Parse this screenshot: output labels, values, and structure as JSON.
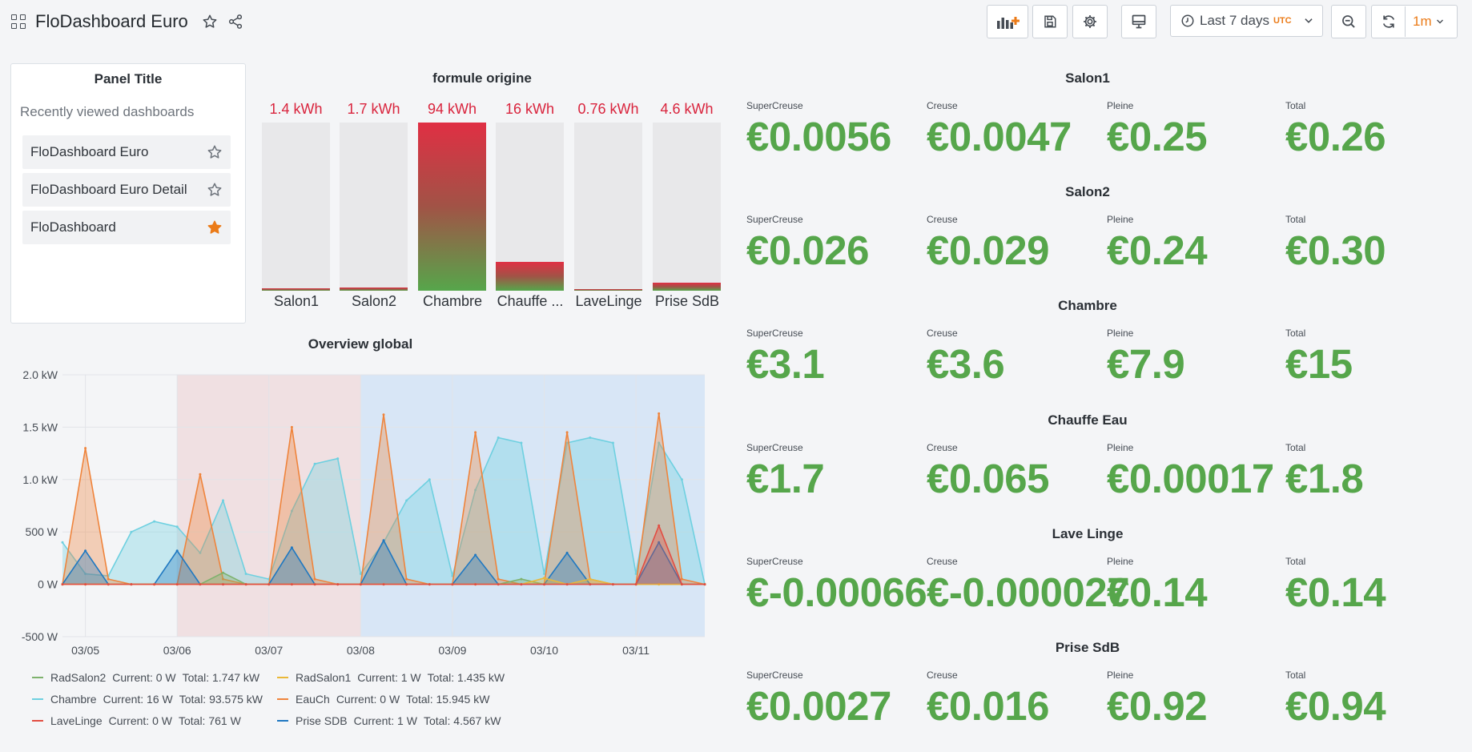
{
  "header": {
    "title": "FloDashboard Euro",
    "time_range": "Last 7 days",
    "timezone": "UTC",
    "refresh_interval": "1m"
  },
  "recent_panel": {
    "title": "Panel Title",
    "subtitle": "Recently viewed dashboards",
    "items": [
      {
        "label": "FloDashboard Euro",
        "starred": false
      },
      {
        "label": "FloDashboard Euro Detail",
        "starred": false
      },
      {
        "label": "FloDashboard",
        "starred": true
      }
    ]
  },
  "bar_gauge": {
    "title": "formule origine",
    "items": [
      {
        "label": "Salon1",
        "value": "1.4 kWh",
        "level": 0.015
      },
      {
        "label": "Salon2",
        "value": "1.7 kWh",
        "level": 0.018
      },
      {
        "label": "Chambre",
        "value": "94 kWh",
        "level": 1.0
      },
      {
        "label": "Chauffe ...",
        "value": "16 kWh",
        "level": 0.17
      },
      {
        "label": "LaveLinge",
        "value": "0.76 kWh",
        "level": 0.008
      },
      {
        "label": "Prise SdB",
        "value": "4.6 kWh",
        "level": 0.049
      }
    ]
  },
  "overview": {
    "title": "Overview global",
    "y_ticks": [
      "2.0 kW",
      "1.5 kW",
      "1.0 kW",
      "500 W",
      "0 W",
      "-500 W"
    ],
    "x_ticks": [
      "03/05",
      "03/06",
      "03/07",
      "03/08",
      "03/09",
      "03/10",
      "03/11"
    ],
    "legend": [
      {
        "name": "RadSalon2",
        "current": "Current: 0 W",
        "total": "Total: 1.747 kW",
        "color": "#7eb26d"
      },
      {
        "name": "RadSalon1",
        "current": "Current: 1 W",
        "total": "Total: 1.435 kW",
        "color": "#eab839"
      },
      {
        "name": "Chambre",
        "current": "Current: 16 W",
        "total": "Total: 93.575 kW",
        "color": "#6ed0e0"
      },
      {
        "name": "EauCh",
        "current": "Current: 0 W",
        "total": "Total: 15.945 kW",
        "color": "#ef843c"
      },
      {
        "name": "LaveLinge",
        "current": "Current: 0 W",
        "total": "Total: 761 W",
        "color": "#e24d42"
      },
      {
        "name": "Prise SDB",
        "current": "Current: 1 W",
        "total": "Total: 4.567 kW",
        "color": "#1f78c1"
      }
    ]
  },
  "chart_data": {
    "type": "line",
    "title": "Overview global",
    "x": [
      "03/04 18:00",
      "03/05 00:00",
      "03/05 06:00",
      "03/05 12:00",
      "03/05 18:00",
      "03/06 00:00",
      "03/06 06:00",
      "03/06 12:00",
      "03/06 18:00",
      "03/07 00:00",
      "03/07 06:00",
      "03/07 12:00",
      "03/07 18:00",
      "03/08 00:00",
      "03/08 06:00",
      "03/08 12:00",
      "03/08 18:00",
      "03/09 00:00",
      "03/09 06:00",
      "03/09 12:00",
      "03/09 18:00",
      "03/10 00:00",
      "03/10 06:00",
      "03/10 12:00",
      "03/10 18:00",
      "03/11 00:00",
      "03/11 06:00",
      "03/11 12:00",
      "03/11 18:00"
    ],
    "ylim": [
      -500,
      2000
    ],
    "series": [
      {
        "name": "Chambre",
        "values": [
          400,
          100,
          80,
          500,
          600,
          550,
          300,
          800,
          100,
          50,
          700,
          1150,
          1200,
          100,
          400,
          800,
          1000,
          80,
          900,
          1400,
          1350,
          100,
          1350,
          1400,
          1350,
          100,
          1350,
          1000,
          0
        ]
      },
      {
        "name": "EauCh",
        "values": [
          0,
          1300,
          50,
          0,
          0,
          0,
          1050,
          50,
          0,
          0,
          1500,
          50,
          0,
          0,
          1620,
          50,
          0,
          0,
          1450,
          50,
          0,
          0,
          1450,
          50,
          0,
          0,
          1630,
          50,
          0
        ]
      },
      {
        "name": "Prise SDB",
        "values": [
          0,
          320,
          0,
          0,
          0,
          320,
          0,
          0,
          0,
          0,
          350,
          0,
          0,
          0,
          420,
          0,
          0,
          0,
          280,
          0,
          0,
          0,
          300,
          0,
          0,
          0,
          400,
          0,
          0
        ]
      },
      {
        "name": "RadSalon2",
        "values": [
          0,
          0,
          0,
          0,
          0,
          0,
          0,
          110,
          0,
          0,
          0,
          0,
          0,
          0,
          0,
          0,
          0,
          0,
          0,
          0,
          50,
          0,
          0,
          0,
          0,
          0,
          0,
          0,
          0
        ]
      },
      {
        "name": "RadSalon1",
        "values": [
          0,
          0,
          0,
          0,
          0,
          0,
          0,
          0,
          0,
          0,
          0,
          0,
          0,
          0,
          0,
          0,
          0,
          0,
          0,
          0,
          0,
          60,
          0,
          50,
          0,
          0,
          0,
          0,
          0
        ]
      },
      {
        "name": "LaveLinge",
        "values": [
          0,
          0,
          0,
          0,
          0,
          0,
          0,
          0,
          0,
          0,
          0,
          0,
          0,
          0,
          0,
          0,
          0,
          0,
          0,
          0,
          0,
          0,
          0,
          0,
          0,
          0,
          560,
          0,
          0
        ]
      }
    ]
  },
  "stats": [
    {
      "room": "Salon1",
      "cells": [
        {
          "label": "SuperCreuse",
          "value": "€0.0056"
        },
        {
          "label": "Creuse",
          "value": "€0.0047"
        },
        {
          "label": "Pleine",
          "value": "€0.25"
        },
        {
          "label": "Total",
          "value": "€0.26"
        }
      ]
    },
    {
      "room": "Salon2",
      "cells": [
        {
          "label": "SuperCreuse",
          "value": "€0.026"
        },
        {
          "label": "Creuse",
          "value": "€0.029"
        },
        {
          "label": "Pleine",
          "value": "€0.24"
        },
        {
          "label": "Total",
          "value": "€0.30"
        }
      ]
    },
    {
      "room": "Chambre",
      "cells": [
        {
          "label": "SuperCreuse",
          "value": "€3.1"
        },
        {
          "label": "Creuse",
          "value": "€3.6"
        },
        {
          "label": "Pleine",
          "value": "€7.9"
        },
        {
          "label": "Total",
          "value": "€15"
        }
      ]
    },
    {
      "room": "Chauffe Eau",
      "cells": [
        {
          "label": "SuperCreuse",
          "value": "€1.7"
        },
        {
          "label": "Creuse",
          "value": "€0.065"
        },
        {
          "label": "Pleine",
          "value": "€0.00017"
        },
        {
          "label": "Total",
          "value": "€1.8"
        }
      ]
    },
    {
      "room": "Lave Linge",
      "cells": [
        {
          "label": "SuperCreuse",
          "value": "€-0.00066"
        },
        {
          "label": "Creuse",
          "value": "€-0.000027"
        },
        {
          "label": "Pleine",
          "value": "€0.14"
        },
        {
          "label": "Total",
          "value": "€0.14"
        }
      ]
    },
    {
      "room": "Prise SdB",
      "cells": [
        {
          "label": "SuperCreuse",
          "value": "€0.0027"
        },
        {
          "label": "Creuse",
          "value": "€0.016"
        },
        {
          "label": "Pleine",
          "value": "€0.92"
        },
        {
          "label": "Total",
          "value": "€0.94"
        }
      ]
    }
  ],
  "colors": {
    "stat_green": "#56a64b",
    "gauge_red": "#d9243d",
    "accent_orange": "#eb7b18"
  }
}
